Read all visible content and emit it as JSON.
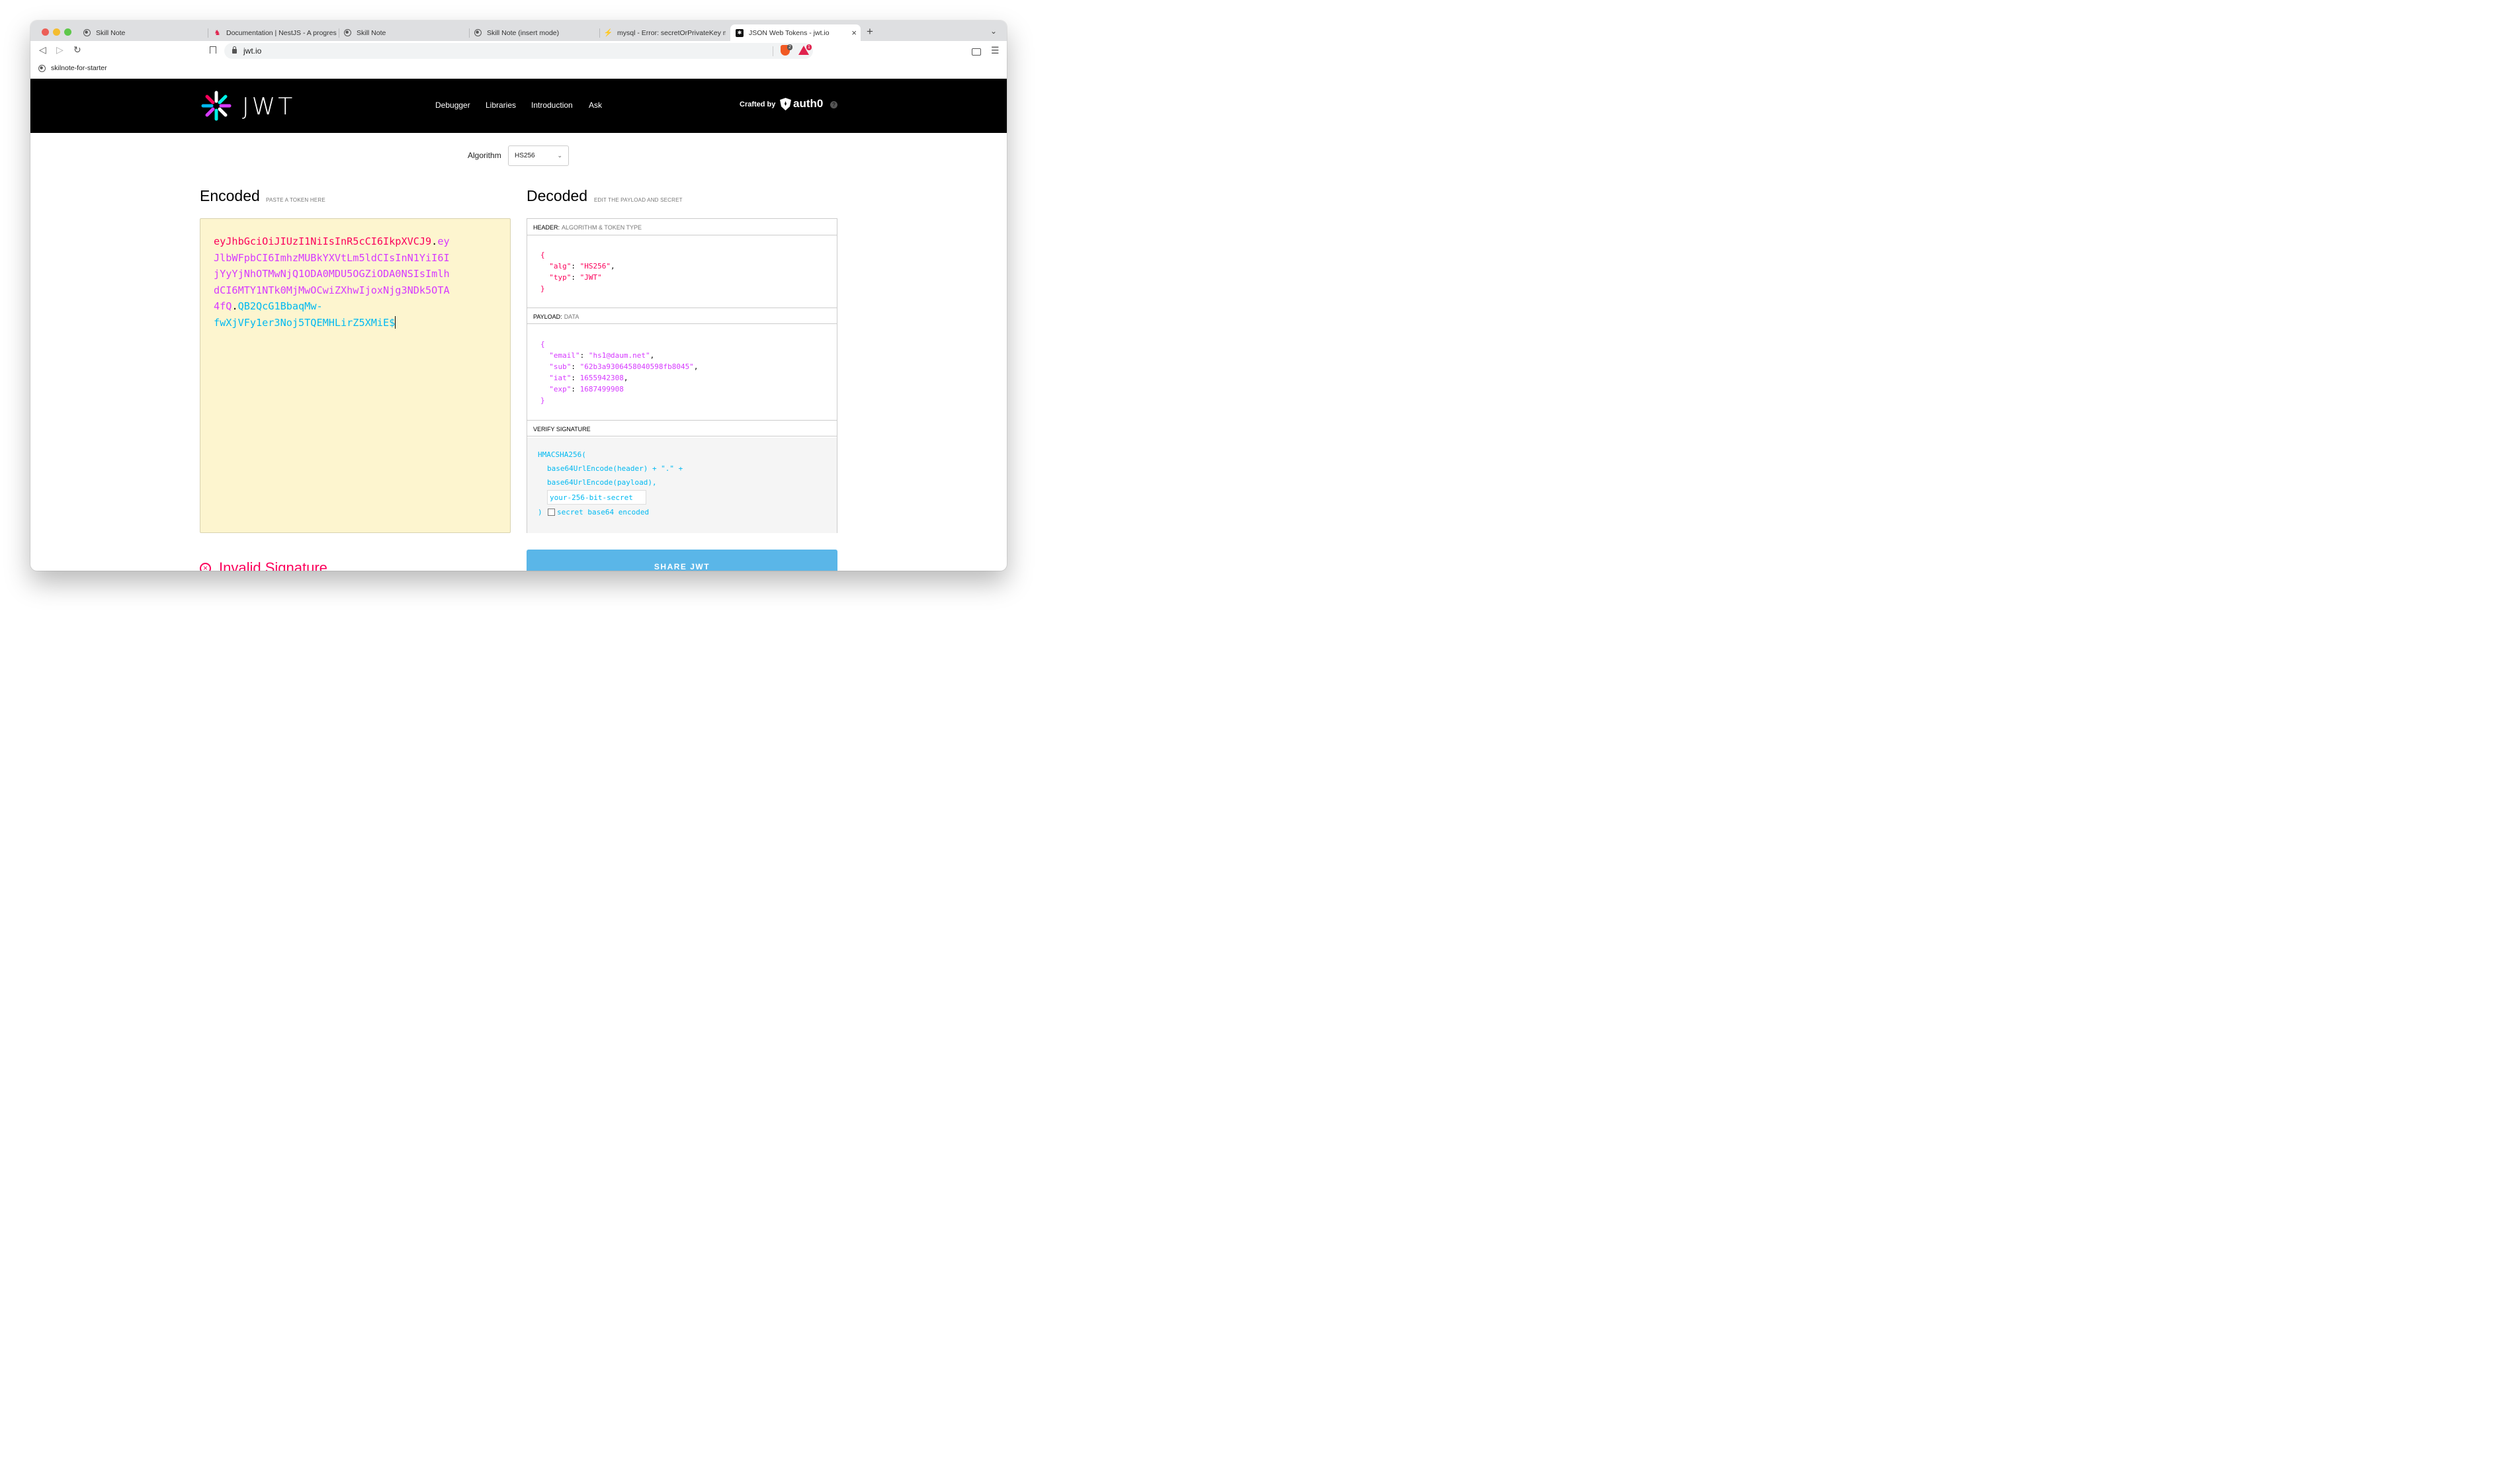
{
  "browser": {
    "tabs": [
      {
        "title": "Skill Note",
        "icon": "globe-icon"
      },
      {
        "title": "Documentation | NestJS - A progres",
        "icon": "nestjs-icon"
      },
      {
        "title": "Skill Note",
        "icon": "globe-icon"
      },
      {
        "title": "Skill Note (insert mode)",
        "icon": "globe-icon"
      },
      {
        "title": "mysql - Error: secretOrPrivateKey m",
        "icon": "stackoverflow-icon"
      },
      {
        "title": "JSON Web Tokens - jwt.io",
        "icon": "jwt-icon",
        "active": true
      }
    ],
    "new_tab_symbol": "+",
    "url": "jwt.io",
    "bookmark": "skilnote-for-starter",
    "brave_badge": "2",
    "rewards_badge": "1"
  },
  "site": {
    "logo_text": "JWT",
    "nav": [
      "Debugger",
      "Libraries",
      "Introduction",
      "Ask"
    ],
    "crafted_by": "Crafted by",
    "auth0": "auth0",
    "help": "?"
  },
  "algorithm": {
    "label": "Algorithm",
    "value": "HS256"
  },
  "encoded": {
    "title": "Encoded",
    "subtitle": "PASTE A TOKEN HERE",
    "token_header": "eyJhbGciOiJIUzI1NiIsInR5cCI6IkpXVCJ9",
    "token_payload": "eyJlbWFpbCI6ImhzMUBkYXVtLm5ldCIsInN1YiI6IjYyYjNhOTMwNjQ1ODA0MDU5OGZiODA0NSIsImlhdCI6MTY1NTk0MjMwOCwiZXhwIjoxNjg3NDk5OTA4fQ",
    "token_signature": "QB2QcG1BbaqMw-fwXjVFy1er3Noj5TQEMHLirZ5XMiE$",
    "lines": [
      {
        "header": "eyJhbGciOiJIUzI1NiIsInR5cCI6IkpXVCJ9",
        "dot": ".",
        "payload": "ey"
      },
      {
        "payload": "JlbWFpbCI6ImhzMUBkYXVtLm5ldCIsInN1YiI6I"
      },
      {
        "payload": "jYyYjNhOTMwNjQ1ODA0MDU5OGZiODA0NSIsImlh"
      },
      {
        "payload": "dCI6MTY1NTk0MjMwOCwiZXhwIjoxNjg3NDk5OTA"
      },
      {
        "payload": "4fQ",
        "dot": ".",
        "sig": "QB2QcG1BbaqMw-"
      },
      {
        "sig": "fwXjVFy1er3Noj5TQEMHLirZ5XMiE$"
      }
    ]
  },
  "decoded": {
    "title": "Decoded",
    "subtitle": "EDIT THE PAYLOAD AND SECRET",
    "header_section": {
      "label": "HEADER:",
      "muted": "ALGORITHM & TOKEN TYPE"
    },
    "header_json": {
      "alg": "HS256",
      "typ": "JWT"
    },
    "payload_section": {
      "label": "PAYLOAD:",
      "muted": "DATA"
    },
    "payload_json": {
      "email": "hs1@daum.net",
      "sub": "62b3a9306458040598fb8045",
      "iat": "1655942308",
      "exp": "1687499908"
    },
    "verify_section": {
      "label": "VERIFY SIGNATURE"
    },
    "verify": {
      "fn_open": "HMACSHA256(",
      "line1": "base64UrlEncode(header) + \".\" +",
      "line2": "base64UrlEncode(payload),",
      "secret_placeholder": "your-256-bit-secret",
      "close": ")",
      "checkbox_label": "secret base64 encoded"
    }
  },
  "status": {
    "invalid": "Invalid Signature"
  },
  "share_button": "SHARE JWT",
  "colors": {
    "header": "#fb015b",
    "payload": "#d63aff",
    "signature": "#00b9f1",
    "encoded_bg": "#fdf5cf",
    "share_bg": "#5ab6e8"
  }
}
